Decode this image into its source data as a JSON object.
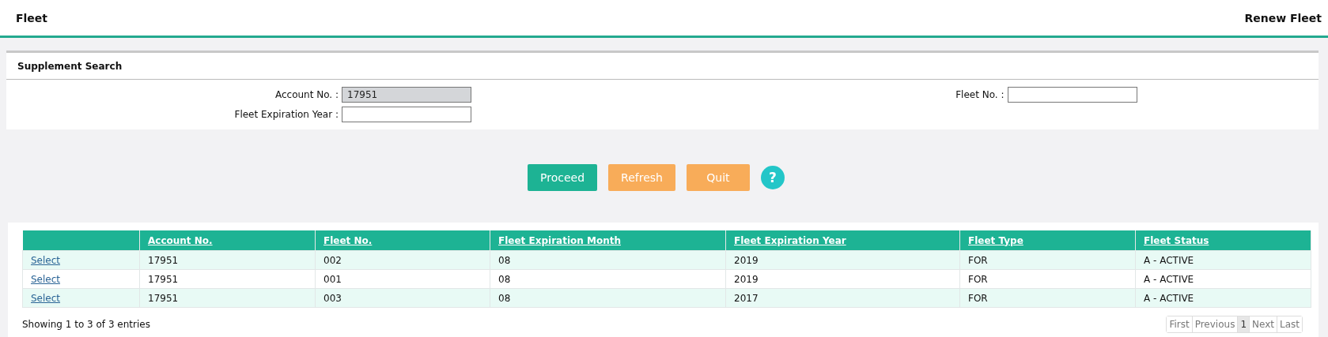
{
  "header": {
    "title": "Fleet",
    "page_title": "Renew Fleet"
  },
  "search_panel": {
    "title": "Supplement Search",
    "fields": [
      {
        "label": "Account No. :",
        "value": "17951",
        "disabled": true
      },
      {
        "label": "Fleet No. :",
        "disabled": false
      },
      {
        "label": "Fleet Expiration Year :",
        "disabled": false
      }
    ]
  },
  "buttons": [
    {
      "label": "Proceed",
      "kind": "primary"
    },
    {
      "label": "Refresh",
      "kind": "warning"
    },
    {
      "label": "Quit",
      "kind": "warning"
    }
  ],
  "help": {
    "label": "?"
  },
  "table": {
    "columns": [
      "",
      "Account No.",
      "Fleet No.",
      "Fleet Expiration Month",
      "Fleet Expiration Year",
      "Fleet Type",
      "Fleet Status"
    ],
    "rows": [
      [
        "Select",
        "17951",
        "002",
        "08",
        "2019",
        "FOR",
        "A - ACTIVE"
      ],
      [
        "Select",
        "17951",
        "001",
        "08",
        "2019",
        "FOR",
        "A - ACTIVE"
      ],
      [
        "Select",
        "17951",
        "003",
        "08",
        "2017",
        "FOR",
        "A - ACTIVE"
      ]
    ]
  },
  "footer": {
    "info": "Showing 1 to 3 of 3 entries",
    "pagination": [
      {
        "label": "First",
        "selected": false
      },
      {
        "label": "Previous",
        "selected": false
      },
      {
        "label": "1",
        "selected": true
      },
      {
        "label": "Next",
        "selected": false
      },
      {
        "label": "Last",
        "selected": false
      }
    ]
  }
}
